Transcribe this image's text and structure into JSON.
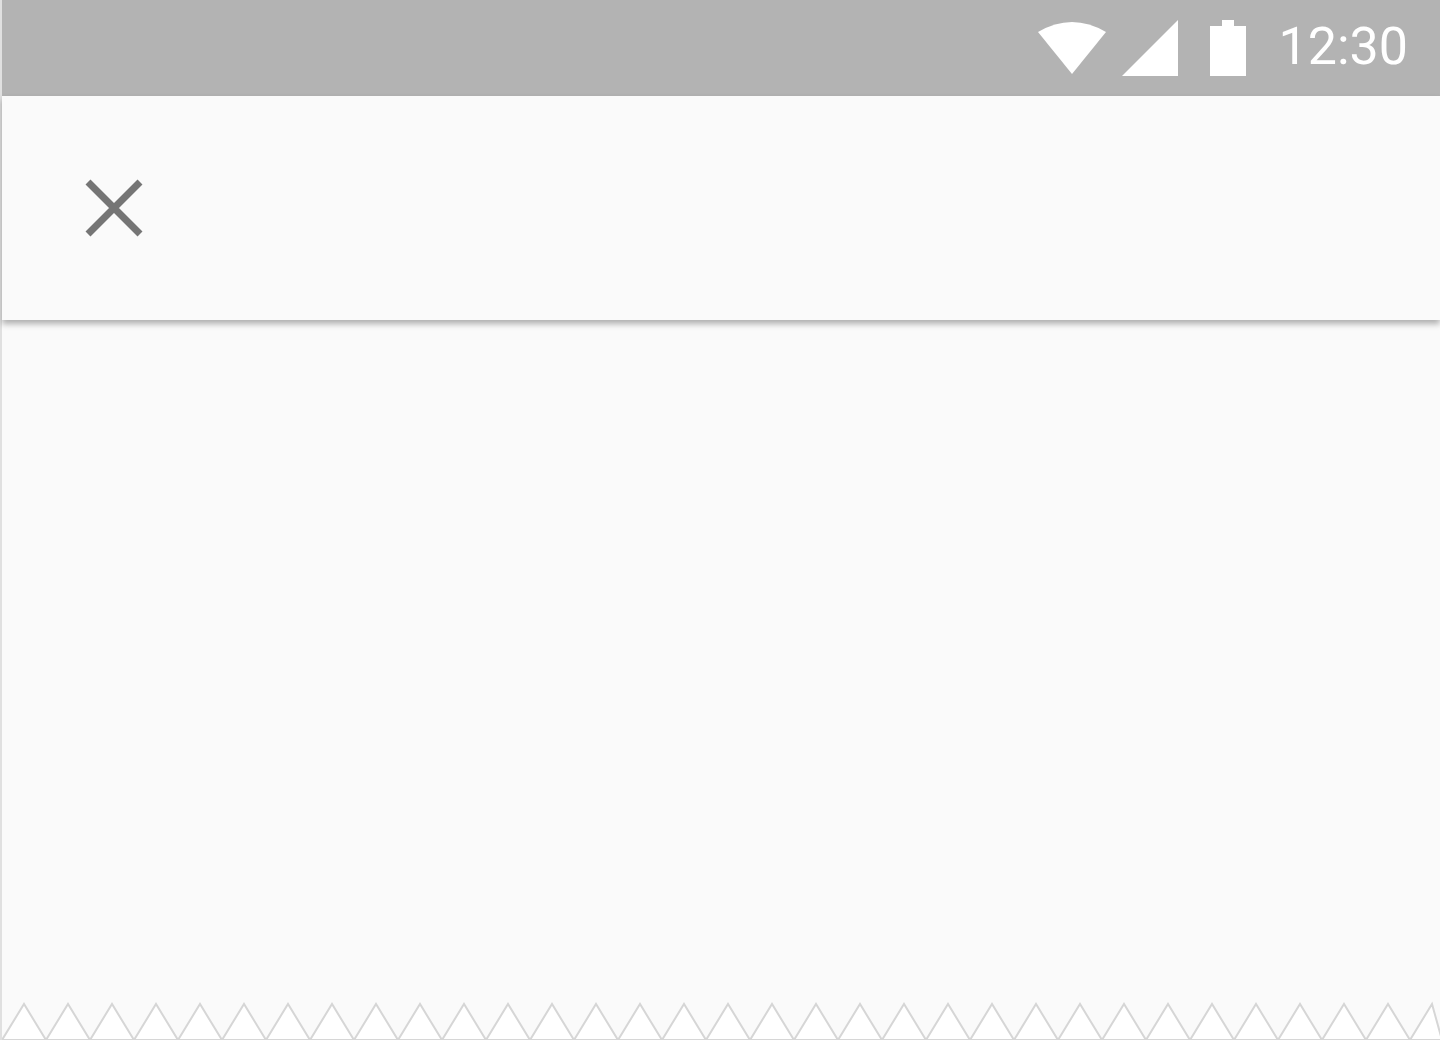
{
  "status_bar": {
    "time": "12:30"
  }
}
